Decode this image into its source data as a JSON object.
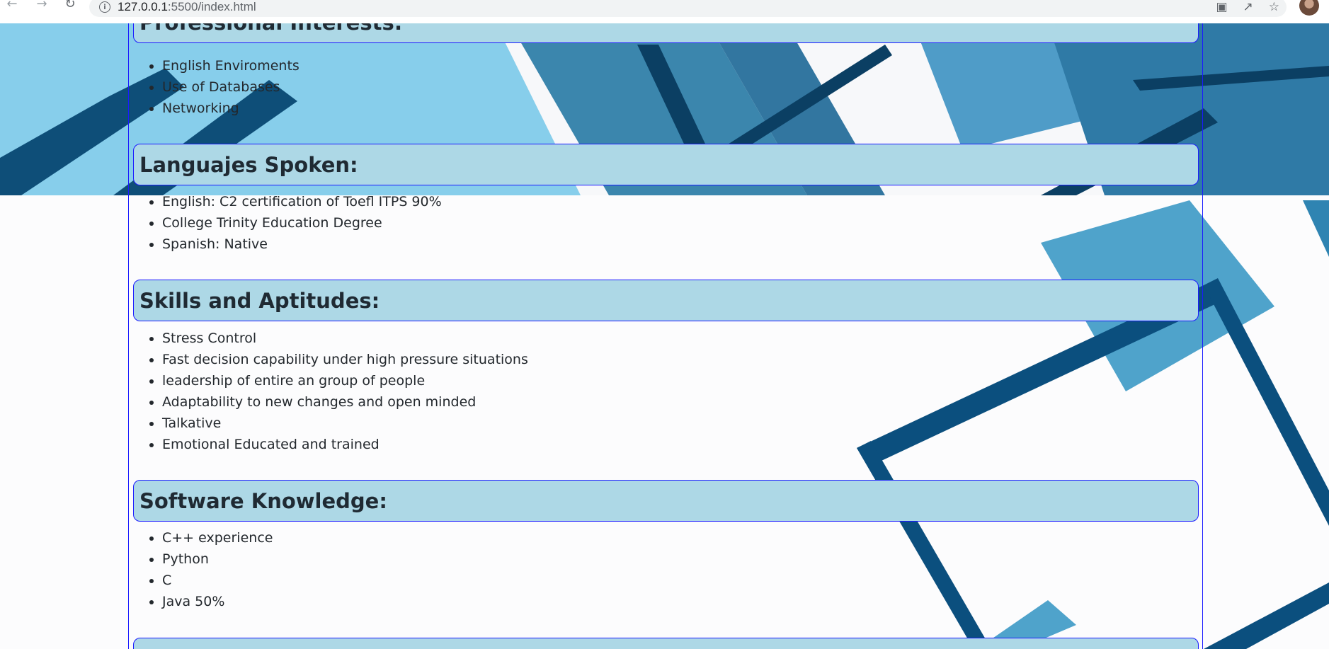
{
  "browser": {
    "url_host": "127.0.0.1",
    "url_path": ":5500/index.html"
  },
  "sections": [
    {
      "title": "Professional Interests:",
      "items": [
        "English Enviroments",
        "Use of Databases",
        "Networking"
      ]
    },
    {
      "title": "Languajes Spoken:",
      "items": [
        "English: C2 certification of Toefl ITPS 90%",
        "College Trinity Education Degree",
        "Spanish: Native"
      ]
    },
    {
      "title": "Skills and Aptitudes:",
      "items": [
        "Stress Control",
        "Fast decision capability under high pressure situations",
        "leadership of entire an group of people",
        "Adaptability to new changes and open minded",
        "Talkative",
        "Emotional Educated and trained"
      ]
    },
    {
      "title": "Software Knowledge:",
      "items": [
        "C++ experience",
        "Python",
        "C",
        "Java 50%"
      ]
    }
  ],
  "colors": {
    "header_bg": "#add8e6",
    "border": "#1a1aff",
    "bg_light_blue": "#87ceeb",
    "bg_mid_blue": "#4a9bc6",
    "bg_dark_blue": "#0b4f7e"
  }
}
